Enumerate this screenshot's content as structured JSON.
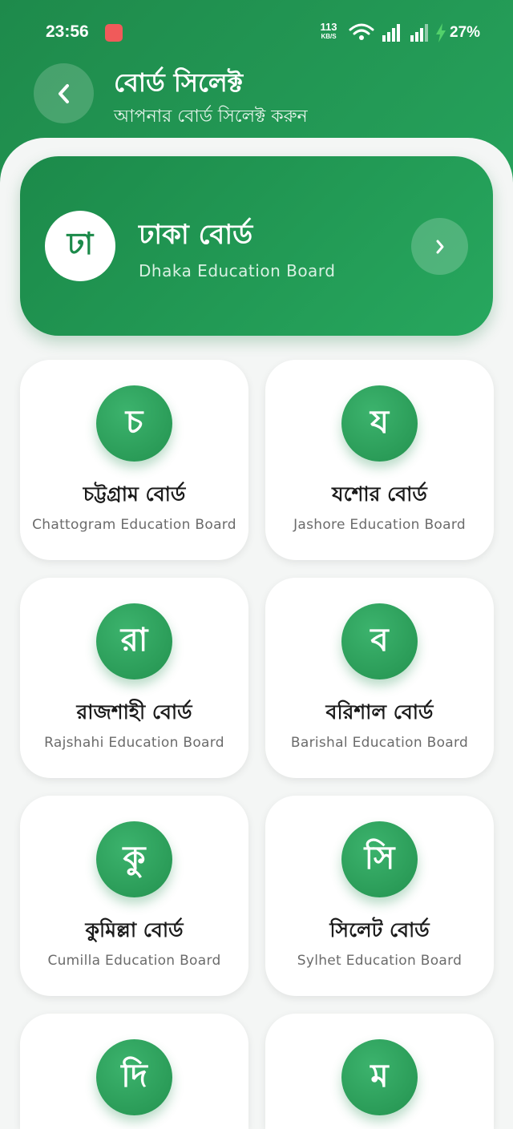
{
  "status_bar": {
    "time": "23:56",
    "speed": "113",
    "speed_unit": "KB/S",
    "battery": "27%"
  },
  "header": {
    "title": "বোর্ড সিলেক্ট",
    "subtitle": "আপনার বোর্ড সিলেক্ট করুন"
  },
  "featured_board": {
    "letter": "ঢা",
    "name": "ঢাকা বোর্ড",
    "english": "Dhaka Education Board"
  },
  "boards": [
    {
      "letter": "চ",
      "name": "চট্টগ্রাম বোর্ড",
      "english": "Chattogram Education Board"
    },
    {
      "letter": "য",
      "name": "যশোর বোর্ড",
      "english": "Jashore Education Board"
    },
    {
      "letter": "রা",
      "name": "রাজশাহী বোর্ড",
      "english": "Rajshahi Education Board"
    },
    {
      "letter": "ব",
      "name": "বরিশাল বোর্ড",
      "english": "Barishal Education Board"
    },
    {
      "letter": "কু",
      "name": "কুমিল্লা বোর্ড",
      "english": "Cumilla Education Board"
    },
    {
      "letter": "সি",
      "name": "সিলেট বোর্ড",
      "english": "Sylhet Education Board"
    },
    {
      "letter": "দি",
      "name": "",
      "english": ""
    },
    {
      "letter": "ম",
      "name": "",
      "english": ""
    }
  ],
  "colors": {
    "primary": "#1e8a4b",
    "primary_light": "#27a75e",
    "background": "#f4f6f5"
  }
}
